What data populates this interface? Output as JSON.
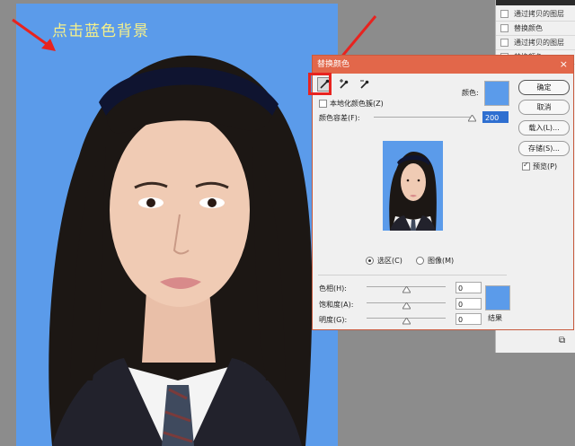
{
  "annotation": {
    "text": "点击蓝色背景"
  },
  "layers": {
    "items": [
      {
        "label": "通过拷贝的图层"
      },
      {
        "label": "替换颜色"
      },
      {
        "label": "通过拷贝的图层"
      },
      {
        "label": "替换颜色"
      }
    ]
  },
  "dialog": {
    "title": "替换颜色",
    "close_icon": "×",
    "localized_label": "本地化颜色簇(Z)",
    "color_label": "颜色:",
    "tolerance_label": "颜色容差(F):",
    "tolerance_value": "200",
    "selection_label": "选区(C)",
    "image_label": "图像(M)",
    "hue_label": "色相(H):",
    "hue_value": "0",
    "saturation_label": "饱和度(A):",
    "saturation_value": "0",
    "lightness_label": "明度(G):",
    "lightness_value": "0",
    "result_label": "结果",
    "buttons": {
      "ok": "确定",
      "cancel": "取消",
      "load": "载入(L)...",
      "save": "存储(S)..."
    },
    "preview_label": "预览(P)",
    "preview_checked": true,
    "selection_selected": true,
    "colors": {
      "target": "#5b9bea",
      "result": "#5b9bea",
      "titlebar": "#e2674a"
    }
  }
}
